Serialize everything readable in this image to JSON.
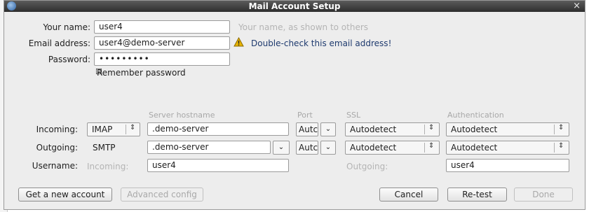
{
  "window": {
    "title": "Mail Account Setup"
  },
  "form": {
    "name_label": "Your name:",
    "name_value": "user4",
    "name_hint": "Your name, as shown to others",
    "email_label": "Email address:",
    "email_value": "user4@demo-server",
    "email_warning": "Double-check this email address!",
    "password_label": "Password:",
    "password_value": "•••••••••",
    "remember_label": "Remember password",
    "remember_checked": true
  },
  "server": {
    "col_hostname": "Server hostname",
    "col_port": "Port",
    "col_ssl": "SSL",
    "col_auth": "Authentication",
    "incoming_label": "Incoming:",
    "incoming_protocol": "IMAP",
    "incoming_hostname": ".demo-server",
    "incoming_port": "Autc",
    "incoming_ssl": "Autodetect",
    "incoming_auth": "Autodetect",
    "outgoing_label": "Outgoing:",
    "outgoing_protocol": "SMTP",
    "outgoing_hostname": ".demo-server",
    "outgoing_port": "Autc",
    "outgoing_ssl": "Autodetect",
    "outgoing_auth": "Autodetect",
    "username_label": "Username:",
    "username_incoming_label": "Incoming:",
    "username_incoming_value": "user4",
    "username_outgoing_label": "Outgoing:",
    "username_outgoing_value": "user4"
  },
  "buttons": {
    "get_account": "Get a new account",
    "advanced": "Advanced config",
    "cancel": "Cancel",
    "retest": "Re-test",
    "done": "Done"
  },
  "icons": {
    "app": "thunderbird-icon",
    "close": "close-icon",
    "warning": "warning-icon",
    "checkbox": "checkbox-checked-icon",
    "combo_arrows": "updown-arrows-icon",
    "dropdown": "chevron-down-icon"
  },
  "colors": {
    "warning": "#e8b400",
    "titlebar": "#3a3a3a"
  }
}
